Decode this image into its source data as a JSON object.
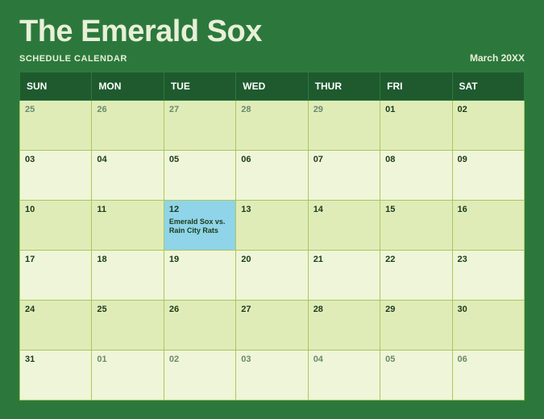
{
  "title": "The Emerald Sox",
  "subtitle": "SCHEDULE CALENDAR",
  "month_label": "March  20XX",
  "day_headers": [
    "SUN",
    "MON",
    "TUE",
    "WED",
    "THUR",
    "FRI",
    "SAT"
  ],
  "weeks": [
    [
      {
        "n": "25",
        "muted": true
      },
      {
        "n": "26",
        "muted": true
      },
      {
        "n": "27",
        "muted": true
      },
      {
        "n": "28",
        "muted": true
      },
      {
        "n": "29",
        "muted": true
      },
      {
        "n": "01",
        "muted": false
      },
      {
        "n": "02",
        "muted": false
      }
    ],
    [
      {
        "n": "03",
        "muted": false
      },
      {
        "n": "04",
        "muted": false
      },
      {
        "n": "05",
        "muted": false
      },
      {
        "n": "06",
        "muted": false
      },
      {
        "n": "07",
        "muted": false
      },
      {
        "n": "08",
        "muted": false
      },
      {
        "n": "09",
        "muted": false
      }
    ],
    [
      {
        "n": "10",
        "muted": false
      },
      {
        "n": "11",
        "muted": false
      },
      {
        "n": "12",
        "muted": false,
        "highlight": true,
        "event": "Emerald Sox vs. Rain City Rats"
      },
      {
        "n": "13",
        "muted": false
      },
      {
        "n": "14",
        "muted": false
      },
      {
        "n": "15",
        "muted": false
      },
      {
        "n": "16",
        "muted": false
      }
    ],
    [
      {
        "n": "17",
        "muted": false
      },
      {
        "n": "18",
        "muted": false
      },
      {
        "n": "19",
        "muted": false
      },
      {
        "n": "20",
        "muted": false
      },
      {
        "n": "21",
        "muted": false
      },
      {
        "n": "22",
        "muted": false
      },
      {
        "n": "23",
        "muted": false
      }
    ],
    [
      {
        "n": "24",
        "muted": false
      },
      {
        "n": "25",
        "muted": false
      },
      {
        "n": "26",
        "muted": false
      },
      {
        "n": "27",
        "muted": false
      },
      {
        "n": "28",
        "muted": false
      },
      {
        "n": "29",
        "muted": false
      },
      {
        "n": "30",
        "muted": false
      }
    ],
    [
      {
        "n": "31",
        "muted": false
      },
      {
        "n": "01",
        "muted": true
      },
      {
        "n": "02",
        "muted": true
      },
      {
        "n": "03",
        "muted": true
      },
      {
        "n": "04",
        "muted": true
      },
      {
        "n": "05",
        "muted": true
      },
      {
        "n": "06",
        "muted": true
      }
    ]
  ]
}
